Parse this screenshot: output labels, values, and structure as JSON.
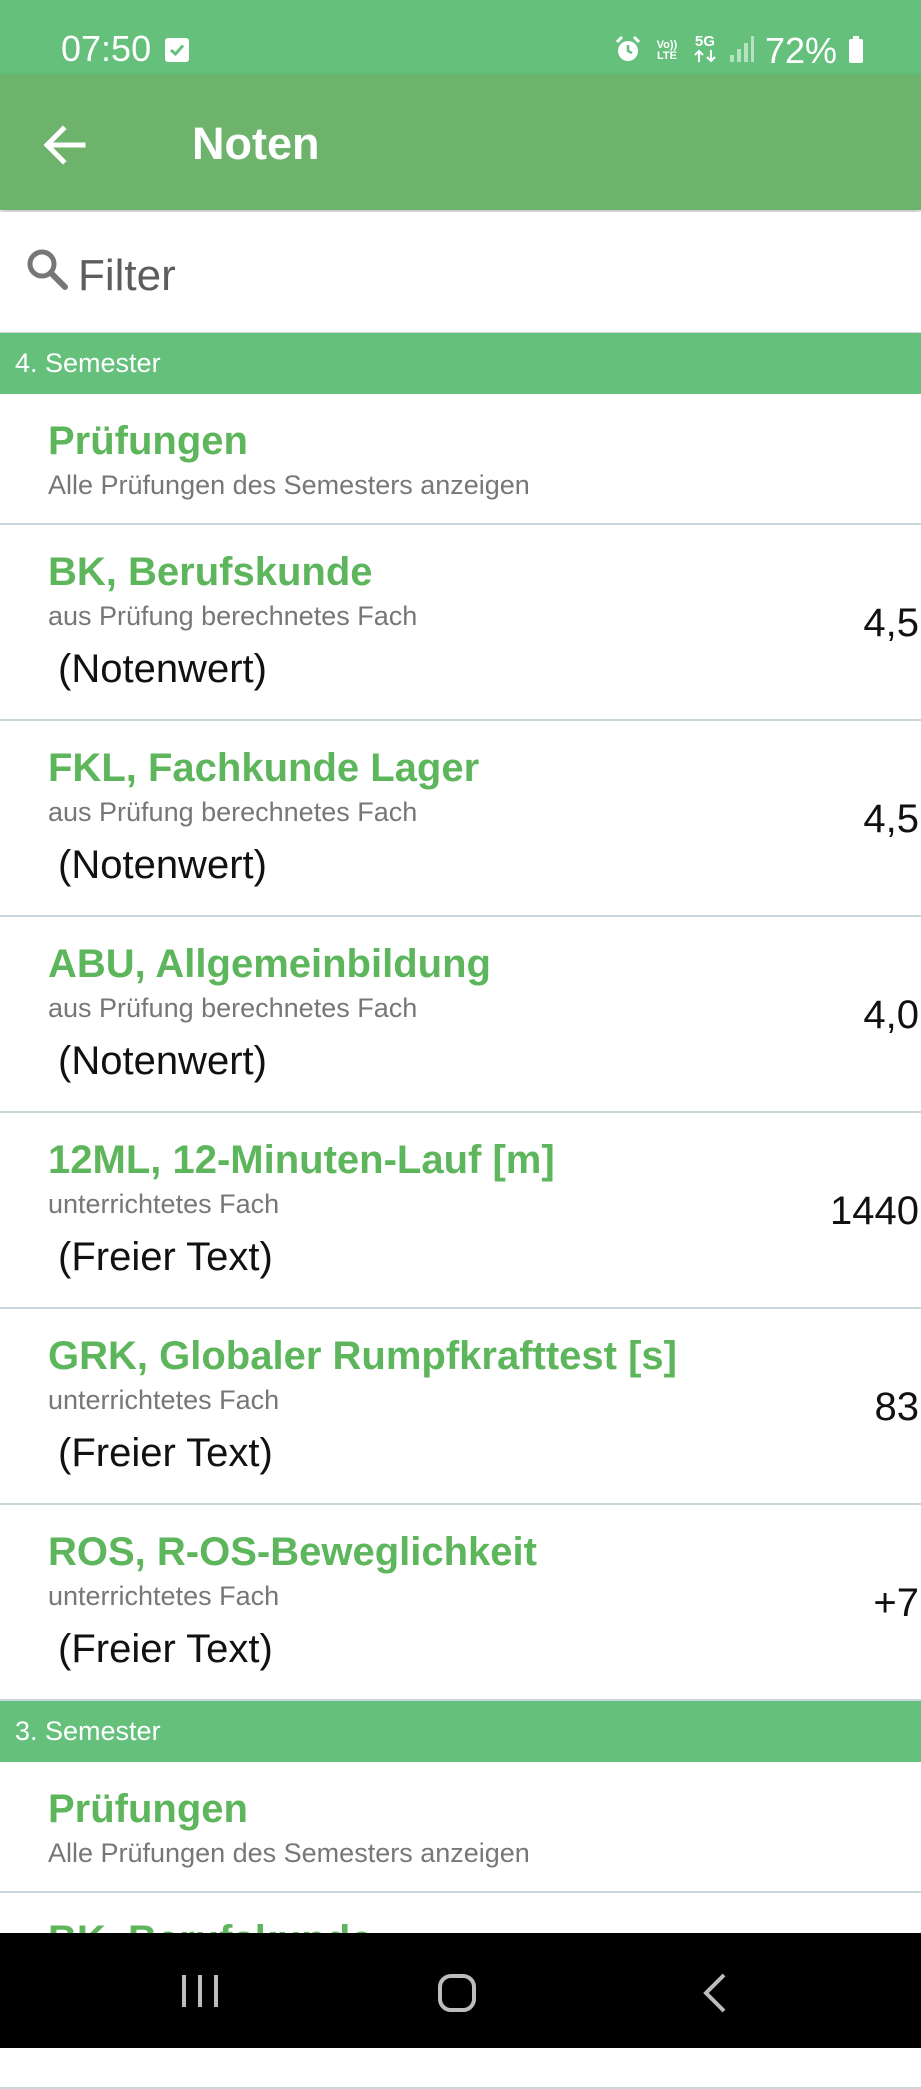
{
  "status": {
    "time": "07:50",
    "battery": "72%",
    "icons": [
      "check-notification-icon",
      "alarm-icon",
      "volte-icon",
      "5g-icon",
      "signal-icon",
      "battery-icon"
    ],
    "volte_top": "Vo))",
    "volte_bottom": "LTE",
    "net_label": "5G"
  },
  "app_bar": {
    "title": "Noten"
  },
  "filter": {
    "placeholder": "Filter"
  },
  "sections": [
    {
      "header": "4. Semester",
      "exams": {
        "title": "Prüfungen",
        "subtitle": "Alle Prüfungen des Semesters anzeigen"
      },
      "subjects": [
        {
          "title": "BK, Berufskunde",
          "subtitle": "aus Prüfung berechnetes Fach",
          "type": "(Notenwert)",
          "value": "4,5"
        },
        {
          "title": "FKL, Fachkunde Lager",
          "subtitle": "aus Prüfung berechnetes Fach",
          "type": "(Notenwert)",
          "value": "4,5"
        },
        {
          "title": "ABU, Allgemeinbildung",
          "subtitle": "aus Prüfung berechnetes Fach",
          "type": "(Notenwert)",
          "value": "4,0"
        },
        {
          "title": "12ML, 12-Minuten-Lauf [m]",
          "subtitle": "unterrichtetes Fach",
          "type": "(Freier Text)",
          "value": "1440"
        },
        {
          "title": "GRK, Globaler Rumpfkrafttest [s]",
          "subtitle": "unterrichtetes Fach",
          "type": "(Freier Text)",
          "value": "83"
        },
        {
          "title": "ROS, R-OS-Beweglichkeit",
          "subtitle": "unterrichtetes Fach",
          "type": "(Freier Text)",
          "value": "+7"
        }
      ]
    },
    {
      "header": "3. Semester",
      "exams": {
        "title": "Prüfungen",
        "subtitle": "Alle Prüfungen des Semesters anzeigen"
      },
      "subjects": [
        {
          "title": "BK, Berufskunde"
        }
      ]
    }
  ],
  "colors": {
    "status_bar": "#65c07c",
    "app_bar": "#6db36b",
    "accent_text": "#5db55c",
    "divider": "#c9d6dc"
  }
}
